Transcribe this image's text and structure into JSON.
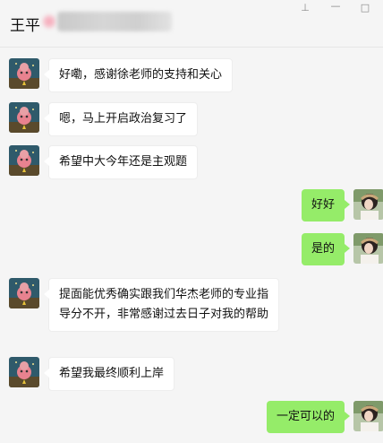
{
  "header": {
    "title": "王平"
  },
  "window_controls": {
    "pin": "⊥",
    "minimize": "—",
    "maximize": "□"
  },
  "messages": [
    {
      "side": "left",
      "text": "好嘞，感谢徐老师的支持和关心"
    },
    {
      "side": "left",
      "text": "嗯，马上开启政治复习了"
    },
    {
      "side": "left",
      "text": "希望中大今年还是主观题"
    },
    {
      "side": "right",
      "text": "好好"
    },
    {
      "side": "right",
      "text": "是的"
    },
    {
      "side": "left",
      "text": "提面能优秀确实跟我们华杰老师的专业指导分不开，非常感谢过去日子对我的帮助"
    },
    {
      "side": "left",
      "text": "希望我最终顺利上岸"
    },
    {
      "side": "right",
      "text": "一定可以的"
    }
  ],
  "colors": {
    "background": "#f5f5f5",
    "bubble_self": "#95ec69",
    "bubble_other": "#ffffff"
  }
}
